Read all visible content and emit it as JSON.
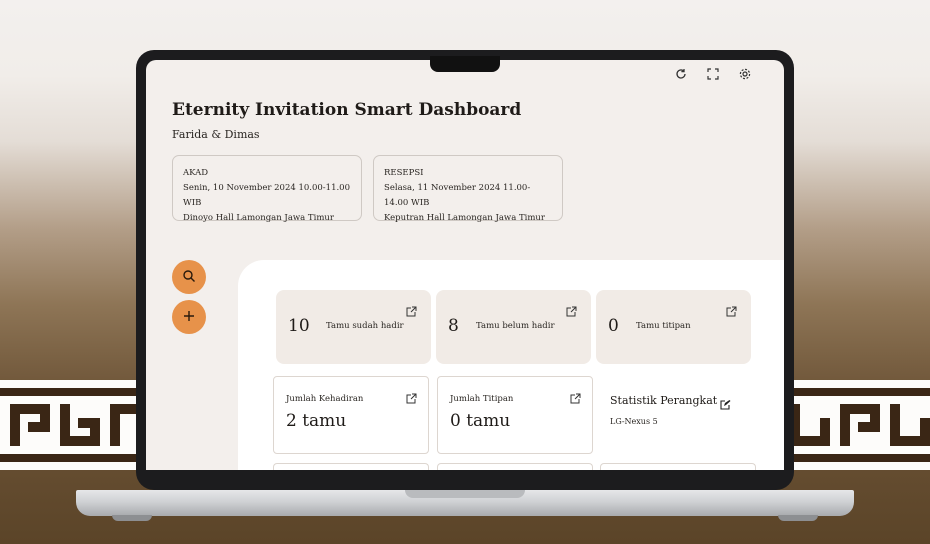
{
  "dashboard": {
    "title": "Eternity Invitation Smart Dashboard",
    "couple": "Farida & Dimas"
  },
  "events": [
    {
      "name": "AKAD",
      "datetime": "Senin, 10 November 2024 10.00-11.00 WIB",
      "location": "Dinoyo Hall Lamongan Jawa Timur"
    },
    {
      "name": "RESEPSI",
      "datetime": "Selasa, 11 November 2024 11.00-14.00 WIB",
      "location": "Keputran Hall Lamongan Jawa Timur"
    }
  ],
  "stats": [
    {
      "count": "10",
      "label": "Tamu sudah hadir"
    },
    {
      "count": "8",
      "label": "Tamu belum hadir"
    },
    {
      "count": "0",
      "label": "Tamu titipan"
    }
  ],
  "cards": [
    {
      "label": "Jumlah Kehadiran",
      "value": "2 tamu"
    },
    {
      "label": "Jumlah Titipan",
      "value": "0 tamu"
    }
  ],
  "device_stats": {
    "title": "Statistik Perangkat",
    "device": "LG-Nexus 5"
  },
  "icons": {
    "refresh": "refresh-icon",
    "fullscreen": "fullscreen-icon",
    "settings": "gear-icon",
    "search": "search-icon",
    "add": "plus-icon",
    "external": "external-link-icon",
    "edit": "edit-icon"
  },
  "colors": {
    "accent": "#e7924a",
    "screen_bg": "#f3efec",
    "stat_bg": "#f1ebe6"
  }
}
